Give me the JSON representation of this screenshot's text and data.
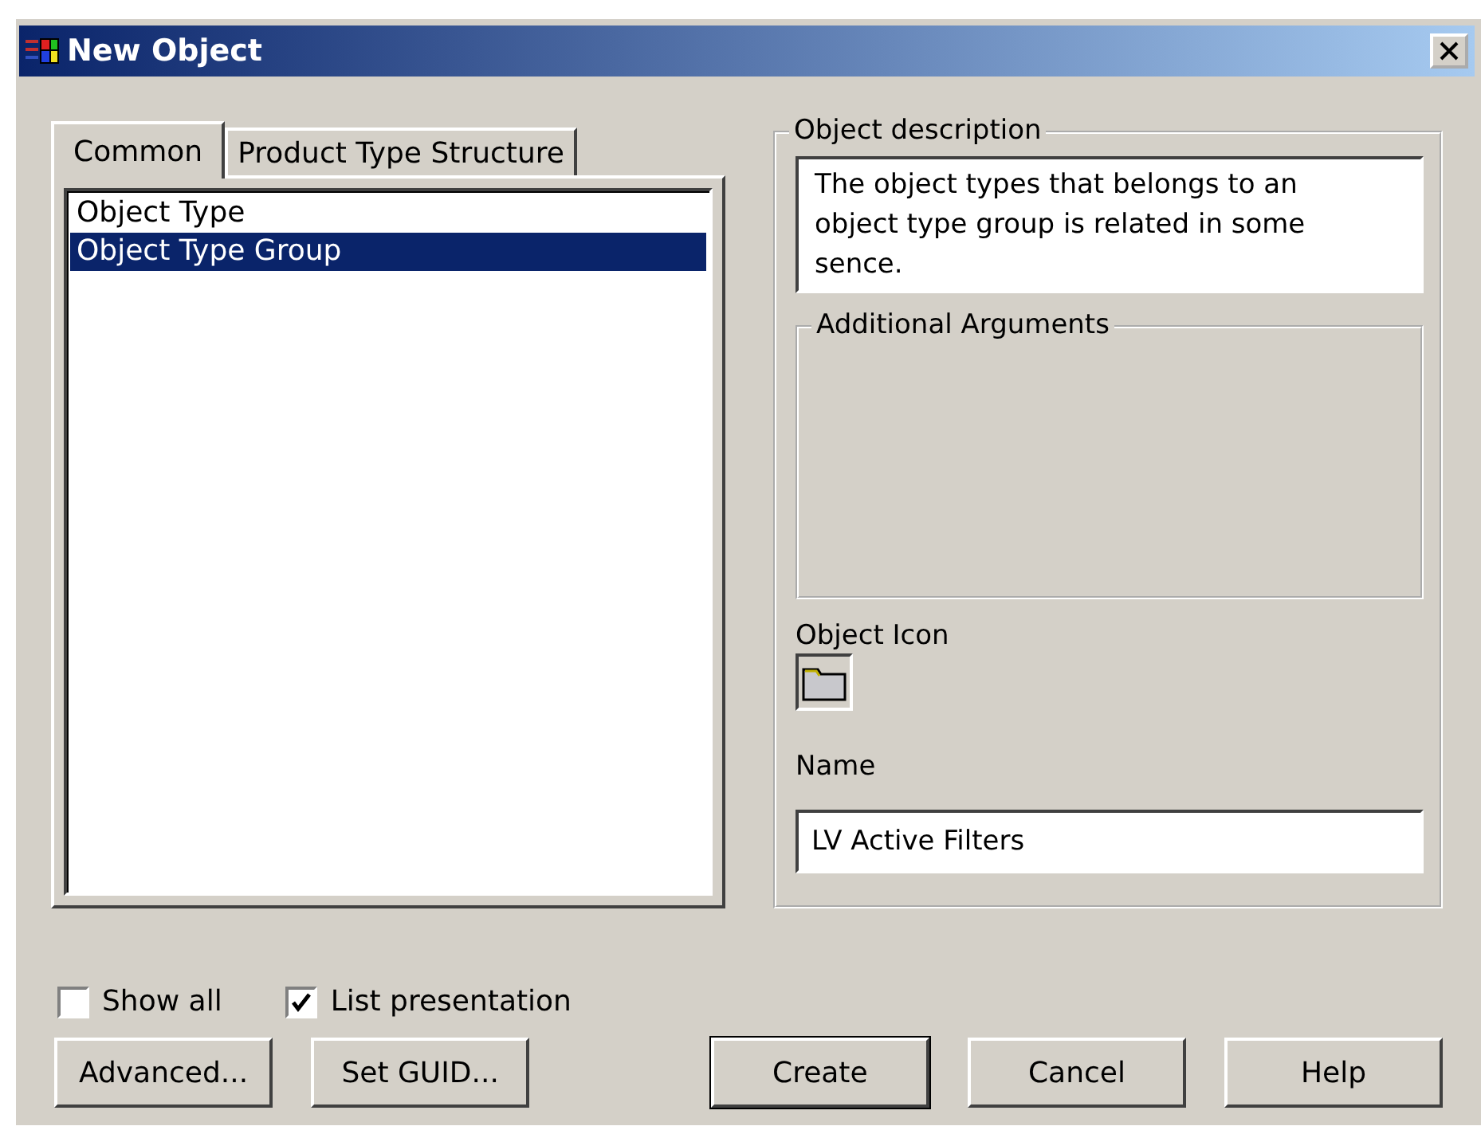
{
  "window": {
    "title": "New Object"
  },
  "tabs": [
    {
      "label": "Common",
      "selected": true
    },
    {
      "label": "Product Type Structure",
      "selected": false
    }
  ],
  "list": {
    "items": [
      {
        "label": "Object Type",
        "selected": false
      },
      {
        "label": "Object Type Group",
        "selected": true
      }
    ]
  },
  "description": {
    "legend": "Object description",
    "text": "The object types that belongs to an object type group is related in some sence."
  },
  "additional_arguments": {
    "legend": "Additional Arguments"
  },
  "object_icon": {
    "label": "Object Icon"
  },
  "name": {
    "label": "Name",
    "value": "LV Active Filters"
  },
  "checkboxes": [
    {
      "label": "Show all",
      "checked": false
    },
    {
      "label": "List presentation",
      "checked": true
    }
  ],
  "left_buttons": [
    {
      "label": "Advanced...",
      "default": false
    },
    {
      "label": "Set GUID...",
      "default": false
    }
  ],
  "right_buttons": [
    {
      "label": "Create",
      "default": true
    },
    {
      "label": "Cancel",
      "default": false
    },
    {
      "label": "Help",
      "default": false
    }
  ]
}
